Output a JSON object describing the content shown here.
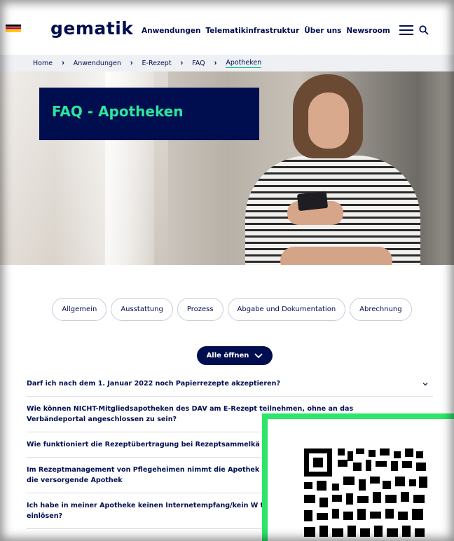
{
  "header": {
    "logo": "gematik",
    "nav": [
      "Anwendungen",
      "Telematikinfrastruktur",
      "Über uns",
      "Newsroom"
    ],
    "menu_icon": "hamburger-menu-icon",
    "search_icon": "search-icon"
  },
  "breadcrumb": [
    "Home",
    "Anwendungen",
    "E-Rezept",
    "FAQ",
    "Apotheken"
  ],
  "hero": {
    "title": "FAQ - Apotheken"
  },
  "filters": [
    "Allgemein",
    "Ausstattung",
    "Prozess",
    "Abgabe und Dokumentation",
    "Abrechnung"
  ],
  "open_all": "Alle öffnen",
  "faq": [
    "Darf ich nach dem 1. Januar 2022 noch Papierrezepte akzeptieren?",
    "Wie können NICHT-Mitgliedsapotheken des DAV am E-Rezept teilnehmen, ohne an das Verbändeportal angeschlossen zu sein?",
    "Wie funktioniert die Rezeptübertragung bei Rezeptsammelkä",
    "Im Rezeptmanagement von Pflegeheimen nimmt die Apothek die elektronischen Verordnungen in die versorgende Apothek",
    "Ich habe in meiner Apotheke keinen Internetempfang/kein W trotzdem das E-Rezept bei mir einlösen?"
  ],
  "colors": {
    "brand_navy": "#000e50",
    "accent_green": "#2ee59d",
    "qr_frame_green": "#2ee56a"
  }
}
